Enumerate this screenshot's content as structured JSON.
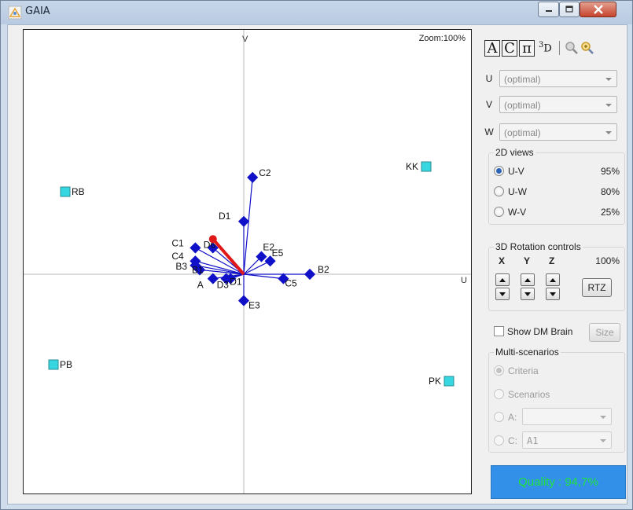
{
  "window": {
    "title": "GAIA"
  },
  "plot": {
    "zoom_label": "Zoom:100%",
    "axis_u_label": "U",
    "axis_v_label": "V",
    "alternatives": [
      {
        "label": "RB",
        "ux": 0.28,
        "uy": 0.52
      },
      {
        "label": "KK",
        "ux": 0.98,
        "uy": 0.58
      },
      {
        "label": "PB",
        "ux": 0.26,
        "uy": 0.2
      },
      {
        "label": "PK",
        "ux": 0.99,
        "uy": 0.23
      }
    ],
    "criteria": [
      {
        "label": "C2",
        "ux": 0.52,
        "uy": 0.57
      },
      {
        "label": "D1",
        "ux": 0.5,
        "uy": 0.47
      },
      {
        "label": "C1",
        "ux": 0.39,
        "uy": 0.41
      },
      {
        "label": "D6",
        "ux": 0.43,
        "uy": 0.41
      },
      {
        "label": "C4",
        "ux": 0.39,
        "uy": 0.38
      },
      {
        "label": "E2",
        "ux": 0.54,
        "uy": 0.39
      },
      {
        "label": "E5",
        "ux": 0.56,
        "uy": 0.38
      },
      {
        "label": "B2",
        "ux": 0.65,
        "uy": 0.35
      },
      {
        "label": "B3",
        "ux": 0.39,
        "uy": 0.37
      },
      {
        "label": "B1",
        "ux": 0.4,
        "uy": 0.36
      },
      {
        "label": "A",
        "ux": 0.43,
        "uy": 0.34
      },
      {
        "label": "D3",
        "ux": 0.46,
        "uy": 0.34
      },
      {
        "label": "D1",
        "ux": 0.47,
        "uy": 0.34
      },
      {
        "label": "C5",
        "ux": 0.59,
        "uy": 0.34
      },
      {
        "label": "E3",
        "ux": 0.5,
        "uy": 0.29
      }
    ],
    "decision_stick": {
      "ux": 0.43,
      "uy": 0.43
    }
  },
  "toolbar": {
    "mode_a": "A",
    "mode_c": "C",
    "mode_pi": "π",
    "mode_3d_sup": "3",
    "mode_3d": "D",
    "zoom_out_icon": "magnifier-icon",
    "zoom_in_icon": "magnifier-plus-icon"
  },
  "axes_selectors": [
    {
      "label": "U",
      "value": "(optimal)"
    },
    {
      "label": "V",
      "value": "(optimal)"
    },
    {
      "label": "W",
      "value": "(optimal)"
    }
  ],
  "views_2d": {
    "title": "2D views",
    "items": [
      {
        "label": "U-V",
        "percent": "95%",
        "checked": true
      },
      {
        "label": "U-W",
        "percent": "80%",
        "checked": false
      },
      {
        "label": "W-V",
        "percent": "25%",
        "checked": false
      }
    ]
  },
  "rotation": {
    "title": "3D Rotation controls",
    "x_label": "X",
    "y_label": "Y",
    "z_label": "Z",
    "percent": "100%",
    "rtz_label": "RTZ"
  },
  "dm_brain": {
    "label": "Show DM Brain",
    "size_label": "Size",
    "checked": false
  },
  "multi_scenarios": {
    "title": "Multi-scenarios",
    "criteria_label": "Criteria",
    "scenarios_label": "Scenarios",
    "a_label": "A:",
    "a_value": "",
    "c_label": "C:",
    "c_value": "A1"
  },
  "quality": {
    "text": "Quality : 94,7%"
  },
  "colors": {
    "criterion": "#1010c8",
    "alternative": "#36d7e0",
    "stick": "#e01818",
    "quality_bg": "#3390e8",
    "quality_text": "#1fe23d"
  }
}
